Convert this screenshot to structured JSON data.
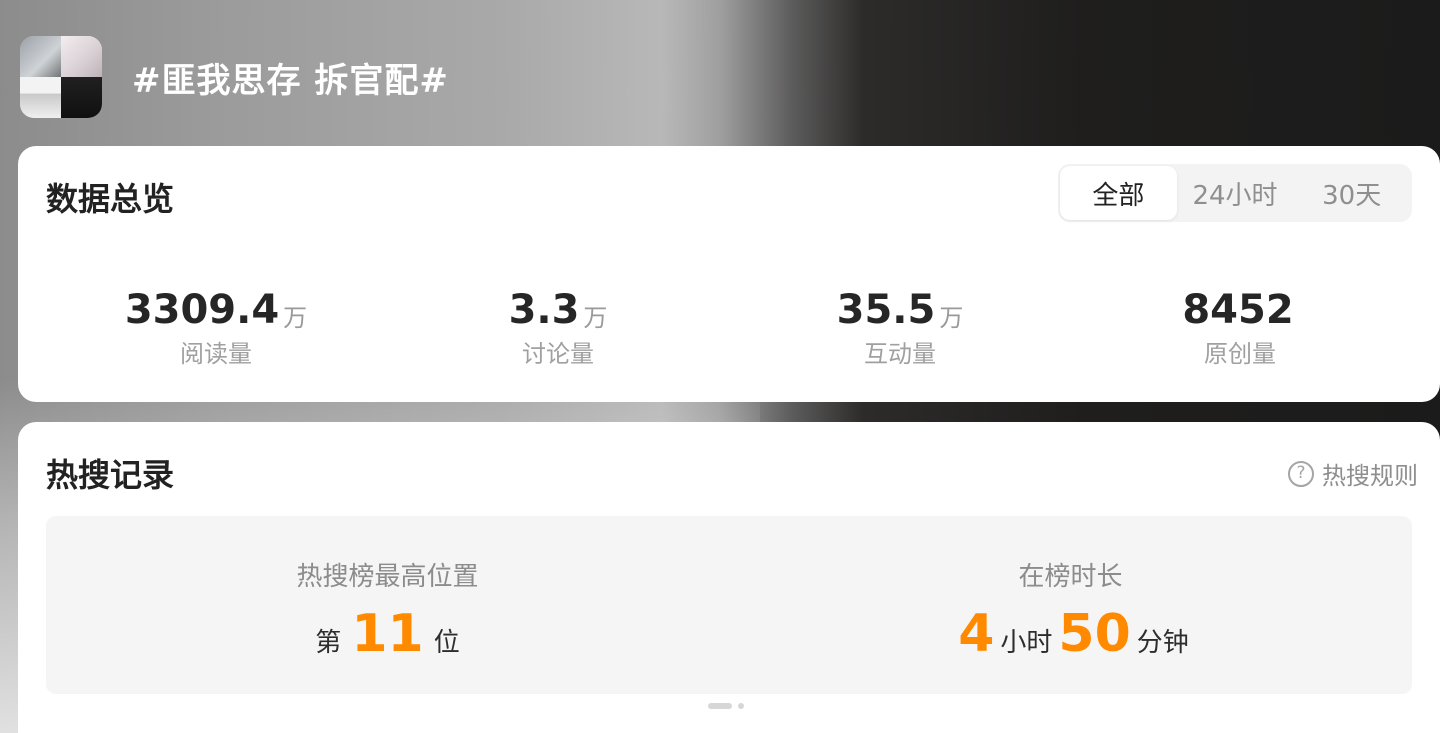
{
  "header": {
    "title": "#匪我思存 拆官配#"
  },
  "overview": {
    "title": "数据总览",
    "tabs": [
      {
        "label": "全部",
        "active": true
      },
      {
        "label": "24小时",
        "active": false
      },
      {
        "label": "30天",
        "active": false
      }
    ],
    "stats": [
      {
        "value": "3309.4",
        "unit": "万",
        "label": "阅读量"
      },
      {
        "value": "3.3",
        "unit": "万",
        "label": "讨论量"
      },
      {
        "value": "35.5",
        "unit": "万",
        "label": "互动量"
      },
      {
        "value": "8452",
        "unit": "",
        "label": "原创量"
      }
    ]
  },
  "hot": {
    "title": "热搜记录",
    "rules_label": "热搜规则",
    "rules_icon": "help-circle-icon",
    "highest": {
      "label": "热搜榜最高位置",
      "prefix": "第",
      "value": "11",
      "suffix": "位"
    },
    "duration": {
      "label": "在榜时长",
      "hours": "4",
      "hours_unit": "小时",
      "minutes": "50",
      "minutes_unit": "分钟"
    },
    "pager": {
      "pages": 2,
      "active": 1
    }
  },
  "colors": {
    "accent": "#ff8a00",
    "text_primary": "#222222",
    "text_secondary": "#9a9a9a"
  }
}
